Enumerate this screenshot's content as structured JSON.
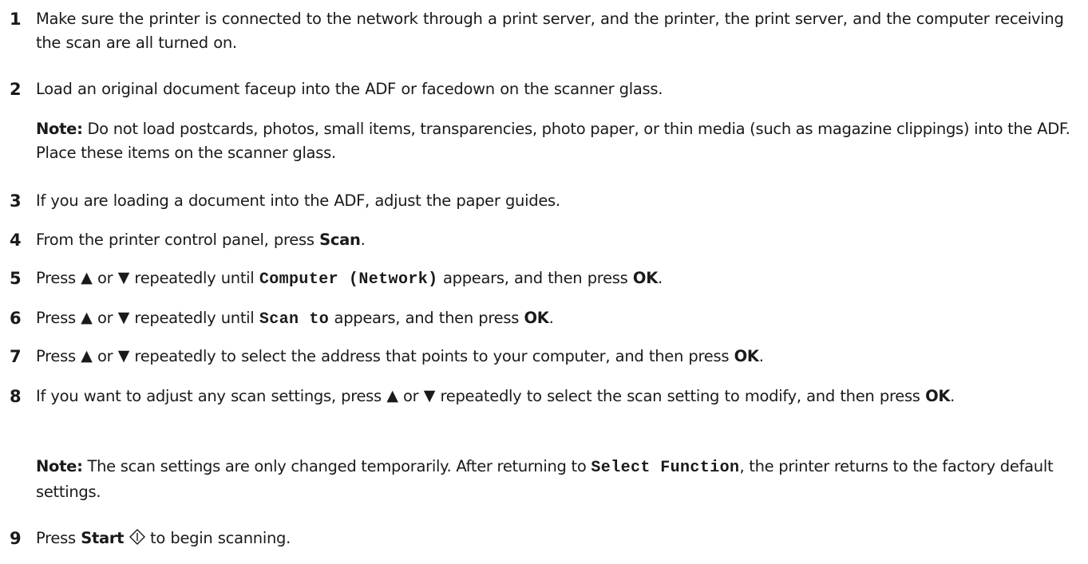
{
  "steps": [
    {
      "number": "1",
      "text": "Make sure the printer is connected to the network through a print server, and the printer, the print server, and the computer receiving the scan are all turned on."
    },
    {
      "number": "2",
      "text": "Load an original document faceup into the ADF or facedown on the scanner glass.",
      "note_label": "Note:",
      "note_text": " Do not load postcards, photos, small items, transparencies, photo paper, or thin media (such as magazine clippings) into the ADF. Place these items on the scanner glass."
    },
    {
      "number": "3",
      "text": "If you are loading a document into the ADF, adjust the paper guides."
    },
    {
      "number": "4",
      "pre": "From the printer control panel, press ",
      "key": "Scan",
      "post": "."
    },
    {
      "number": "5",
      "pre": "Press ",
      "or": " or ",
      "mid": " repeatedly until ",
      "code": "Computer (Network)",
      "post": " appears, and then press ",
      "key": "OK",
      "end": "."
    },
    {
      "number": "6",
      "pre": "Press ",
      "or": " or ",
      "mid": " repeatedly until ",
      "code": "Scan to",
      "post": " appears, and then press ",
      "key": "OK",
      "end": "."
    },
    {
      "number": "7",
      "pre": "Press ",
      "or": " or ",
      "mid": " repeatedly to select the address that points to your computer, and then press ",
      "key": "OK",
      "end": "."
    },
    {
      "number": "8",
      "pre": "If you want to adjust any scan settings, press ",
      "or": " or ",
      "mid": " repeatedly to select the scan setting to modify, and then press ",
      "key": "OK",
      "end": ".",
      "note_label": "Note:",
      "note_pre": " The scan settings are only changed temporarily. After returning to ",
      "note_code": "Select Function",
      "note_post": ", the printer returns to the factory default settings."
    },
    {
      "number": "9",
      "pre": "Press ",
      "key": "Start",
      "post": " to begin scanning."
    }
  ],
  "icons": {
    "up": "▲",
    "down": "▼"
  }
}
